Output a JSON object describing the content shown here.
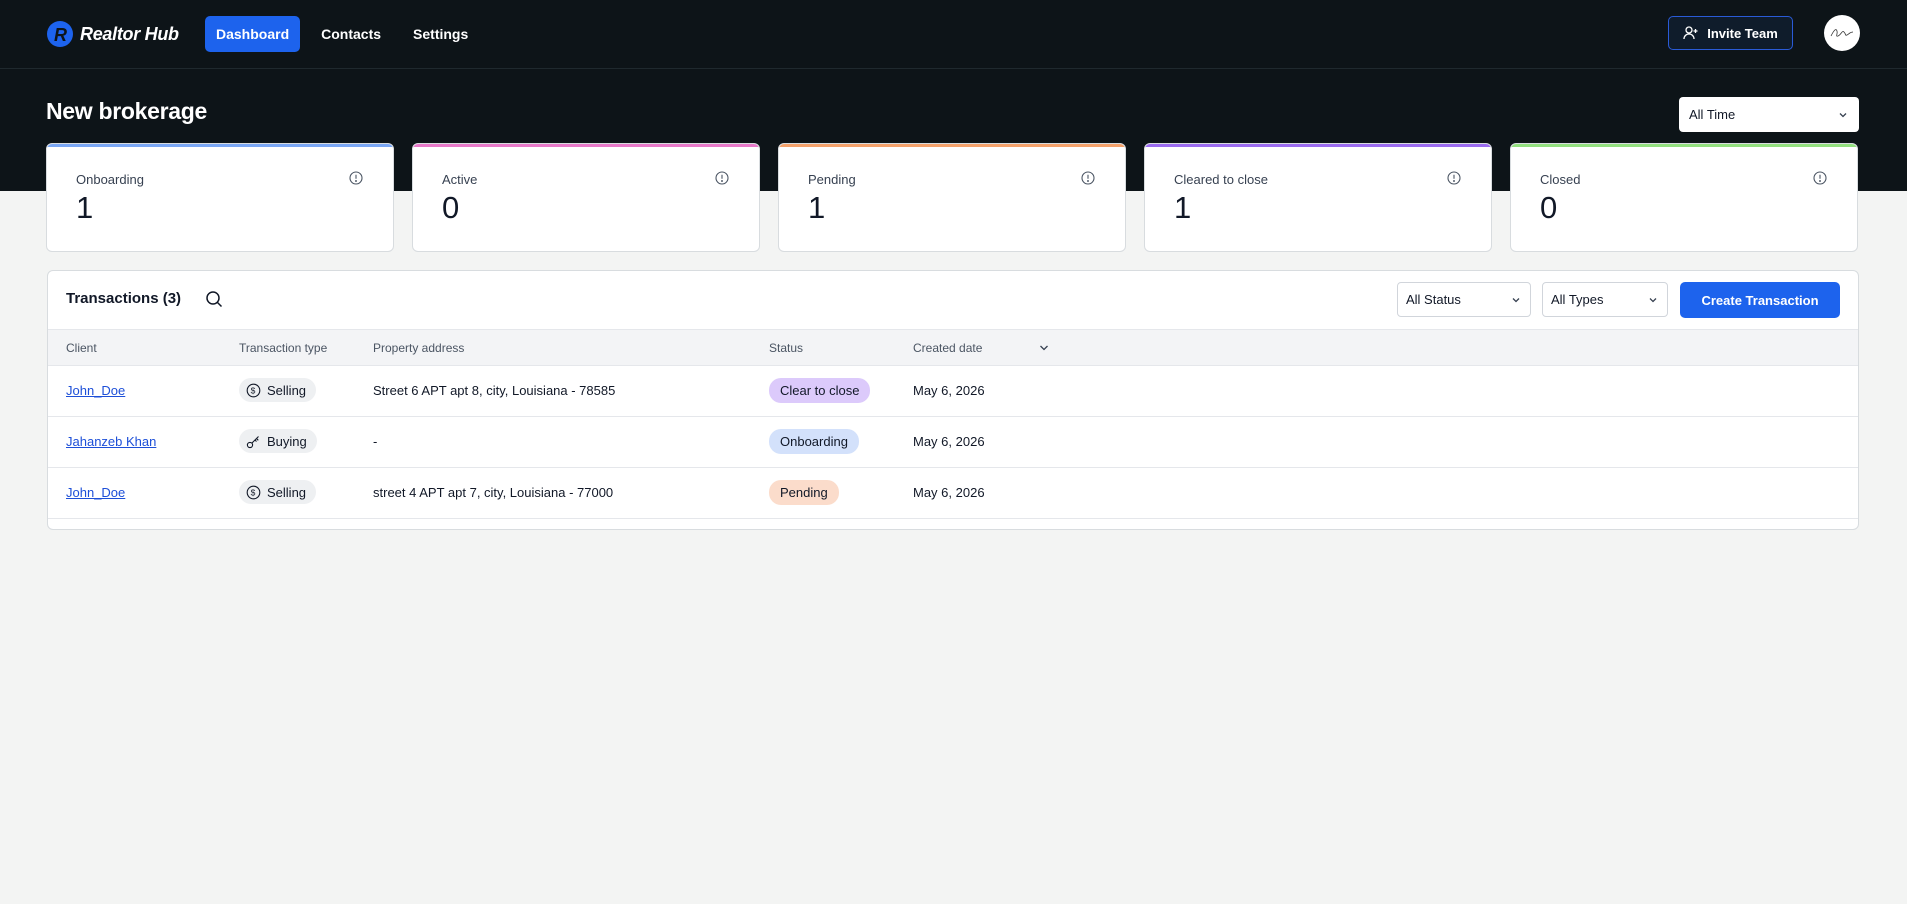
{
  "brand": {
    "name": "Realtor Hub",
    "accent": "#1d63ed"
  },
  "nav": {
    "items": [
      {
        "label": "Dashboard",
        "active": true
      },
      {
        "label": "Contacts",
        "active": false
      },
      {
        "label": "Settings",
        "active": false
      }
    ]
  },
  "header": {
    "invite_label": "Invite Team",
    "page_title": "New brokerage",
    "time_filter": "All Time"
  },
  "cards": [
    {
      "label": "Onboarding",
      "value": "1",
      "color": "#7aa7f5"
    },
    {
      "label": "Active",
      "value": "0",
      "color": "#e879c9"
    },
    {
      "label": "Pending",
      "value": "1",
      "color": "#f5a26b"
    },
    {
      "label": "Cleared to close",
      "value": "1",
      "color": "#9b6cf0"
    },
    {
      "label": "Closed",
      "value": "0",
      "color": "#93e07f"
    }
  ],
  "transactions": {
    "title": "Transactions (3)",
    "status_filter": "All Status",
    "type_filter": "All Types",
    "create_label": "Create Transaction",
    "columns": [
      "Client",
      "Transaction type",
      "Property address",
      "Status",
      "Created date"
    ],
    "rows": [
      {
        "client": "John_Doe",
        "type": "Selling",
        "type_icon": "dollar-icon",
        "address": "Street 6 APT apt 8, city, Louisiana - 78585",
        "status": "Clear to close",
        "status_color": "#dccafb",
        "date": "May 6, 2026"
      },
      {
        "client": "Jahanzeb Khan",
        "type": "Buying",
        "type_icon": "key-icon",
        "address": "-",
        "status": "Onboarding",
        "status_color": "#d3e1fb",
        "date": "May 6, 2026"
      },
      {
        "client": "John_Doe",
        "type": "Selling",
        "type_icon": "dollar-icon",
        "address": "street 4 APT apt 7, city, Louisiana - 77000",
        "status": "Pending",
        "status_color": "#fbdccb",
        "date": "May 6, 2026"
      }
    ]
  }
}
